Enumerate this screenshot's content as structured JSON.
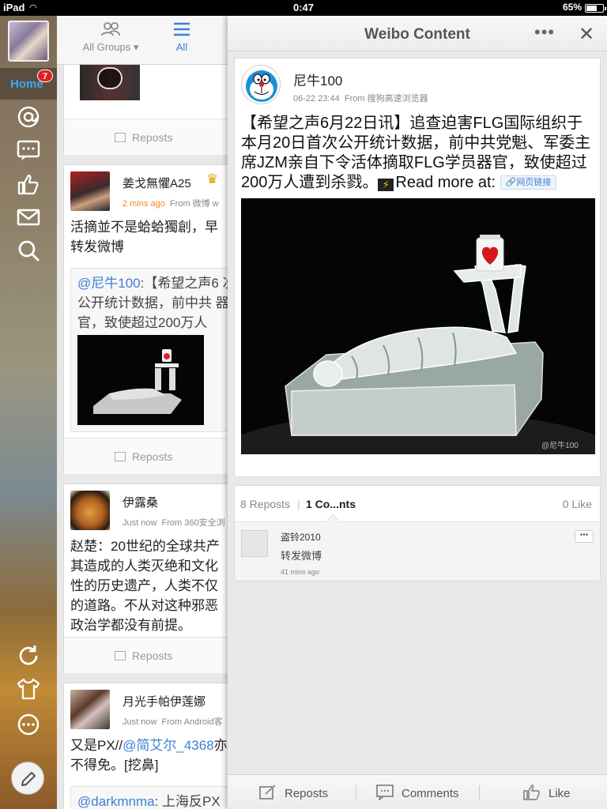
{
  "status_bar": {
    "device": "iPad",
    "time": "0:47",
    "battery": "65%",
    "battery_level": 0.65
  },
  "sidebar": {
    "home_label": "Home",
    "home_badge": "7",
    "icons": [
      "at-icon",
      "messages-icon",
      "like-icon",
      "mail-icon",
      "search-icon",
      "refresh-icon",
      "theme-icon",
      "more-icon",
      "compose-icon"
    ]
  },
  "feed": {
    "tabs": {
      "groups": "All Groups ▾",
      "all": "All"
    },
    "repost_label": "Reposts",
    "posts": [
      {
        "name": "姜戈無懼A25",
        "time": "2 mins ago",
        "source": "From 微博 w",
        "text": "活摘並不是蛤蛤獨創，早 转发微博",
        "quote_user": "@尼牛100",
        "quote_text": ":【希望之声6 次公开统计数据，前中共 器官，致使超过200万人"
      },
      {
        "name": "伊露桑",
        "time": "Just now",
        "source": "From 360安全浏",
        "text": "赵楚：20世纪的全球共产 其造成的人类灭绝和文化 性的历史遗产，人类不仅 的道路。不从对这种邪恶 政治学都没有前提。"
      },
      {
        "name": "月光手帕伊莲娜",
        "time": "Just now",
        "source": "From Android客",
        "text_pre": "又是PX//",
        "text_link": "@简艾尔_4368",
        "text_post": "亦不得免。[挖鼻]",
        "quote_user": "@darkmnma",
        "quote_text": ": 上海反PX"
      }
    ]
  },
  "detail": {
    "title": "Weibo Content",
    "post": {
      "name": "尼牛100",
      "time": "06-22 23:44",
      "source": "From 搜狗高速浏览器",
      "text": "【希望之声6月22日讯】追查迫害FLG国际组织于本月20日首次公开统计数据，前中共党魁、军委主席JZM亲自下令活体摘取FLG学员器官，致使超过200万人遭到杀戮。",
      "read_more": "Read more at:",
      "link_label": "🔗网页链接",
      "image_watermark": "@尼牛100"
    },
    "tabs": {
      "reposts": "8 Reposts",
      "comments": "1 Co...nts",
      "likes": "0 Like"
    },
    "comment": {
      "name": "盗铃2010",
      "text": "转发微博",
      "time": "41 mins ago",
      "more": "•••"
    },
    "toolbar": {
      "reposts": "Reposts",
      "comments": "Comments",
      "like": "Like"
    }
  }
}
